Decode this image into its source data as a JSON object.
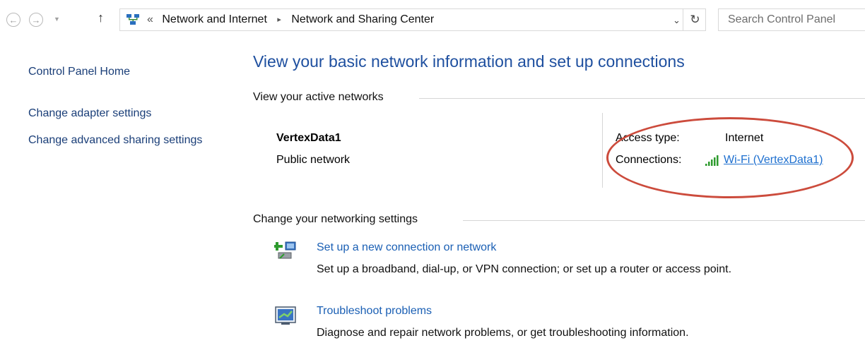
{
  "breadcrumb": {
    "overflow": "«",
    "items": [
      "Network and Internet",
      "Network and Sharing Center"
    ],
    "separator": "▸"
  },
  "search": {
    "placeholder": "Search Control Panel"
  },
  "sidebar": {
    "links": [
      "Control Panel Home",
      "Change adapter settings",
      "Change advanced sharing settings"
    ]
  },
  "main": {
    "title": "View your basic network information and set up connections",
    "active_section": "View your active networks",
    "network": {
      "name": "VertexData1",
      "type": "Public network"
    },
    "access_label": "Access type:",
    "access_value": "Internet",
    "connections_label": "Connections:",
    "connection_link": "Wi-Fi (VertexData1)",
    "change_section": "Change your networking settings",
    "tasks": [
      {
        "link": "Set up a new connection or network",
        "desc": "Set up a broadband, dial-up, or VPN connection; or set up a router or access point."
      },
      {
        "link": "Troubleshoot problems",
        "desc": "Diagnose and repair network problems, or get troubleshooting information."
      }
    ]
  },
  "icons": {
    "back": "back-arrow-icon",
    "forward": "forward-arrow-icon",
    "up": "up-arrow-icon",
    "refresh": "refresh-icon",
    "network": "network-icon",
    "wifi": "wifi-signal-icon",
    "new_connection": "new-connection-icon",
    "troubleshoot": "troubleshoot-icon"
  },
  "colors": {
    "link": "#1a5fb4",
    "title": "#1e4f9f",
    "highlight_ring": "#cc4b3c",
    "wifi": "#2e9b2e"
  }
}
